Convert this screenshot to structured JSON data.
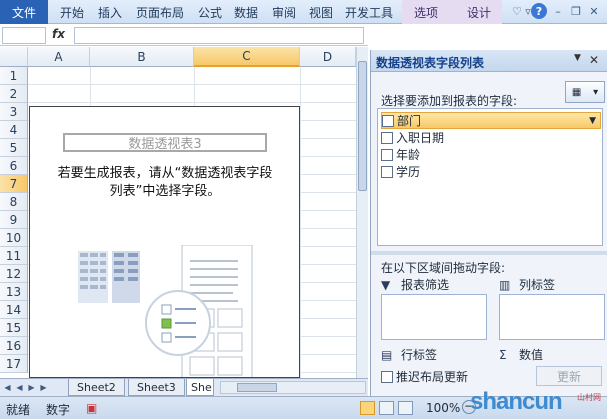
{
  "ribbon": {
    "file_label": "文件",
    "tabs": [
      "开始",
      "插入",
      "页面布局",
      "公式",
      "数据",
      "审阅",
      "视图",
      "开发工具"
    ],
    "context_tabs": [
      "选项",
      "设计"
    ],
    "icons": [
      "heart-icon",
      "caret-icon",
      "help-icon",
      "minimize-icon",
      "restore-icon",
      "close-icon"
    ]
  },
  "formula_bar": {
    "name_value": "",
    "fx_label": "fx",
    "formula_value": ""
  },
  "grid": {
    "columns": [
      "A",
      "B",
      "C",
      "D"
    ],
    "selected_column": "C",
    "rows": [
      "1",
      "2",
      "3",
      "4",
      "5",
      "6",
      "7",
      "8",
      "9",
      "10",
      "11",
      "12",
      "13",
      "14",
      "15",
      "16",
      "17"
    ],
    "selected_row": "7"
  },
  "pivot": {
    "title": "数据透视表3",
    "message_line1": "若要生成报表，请从“数据透视表字段",
    "message_line2": "列表”中选择字段。"
  },
  "sheets": {
    "tabs": [
      "Sheet2",
      "Sheet3",
      "She"
    ],
    "active": "She"
  },
  "status": {
    "ready": "就绪",
    "mode": "数字",
    "zoom": "100%"
  },
  "watermark": {
    "text": "shancun",
    "sub": "山村网"
  },
  "field_pane": {
    "title": "数据透视表字段列表",
    "choose_label": "选择要添加到报表的字段:",
    "fields": [
      {
        "name": "部门",
        "checked": false,
        "highlighted": true
      },
      {
        "name": "入职日期",
        "checked": false,
        "highlighted": false
      },
      {
        "name": "年龄",
        "checked": false,
        "highlighted": false
      },
      {
        "name": "学历",
        "checked": false,
        "highlighted": false
      }
    ],
    "drag_label": "在以下区域间拖动字段:",
    "zones": {
      "filter": "报表筛选",
      "columns": "列标签",
      "rows": "行标签",
      "values": "数值"
    },
    "defer_label": "推迟布局更新",
    "update_label": "更新"
  }
}
